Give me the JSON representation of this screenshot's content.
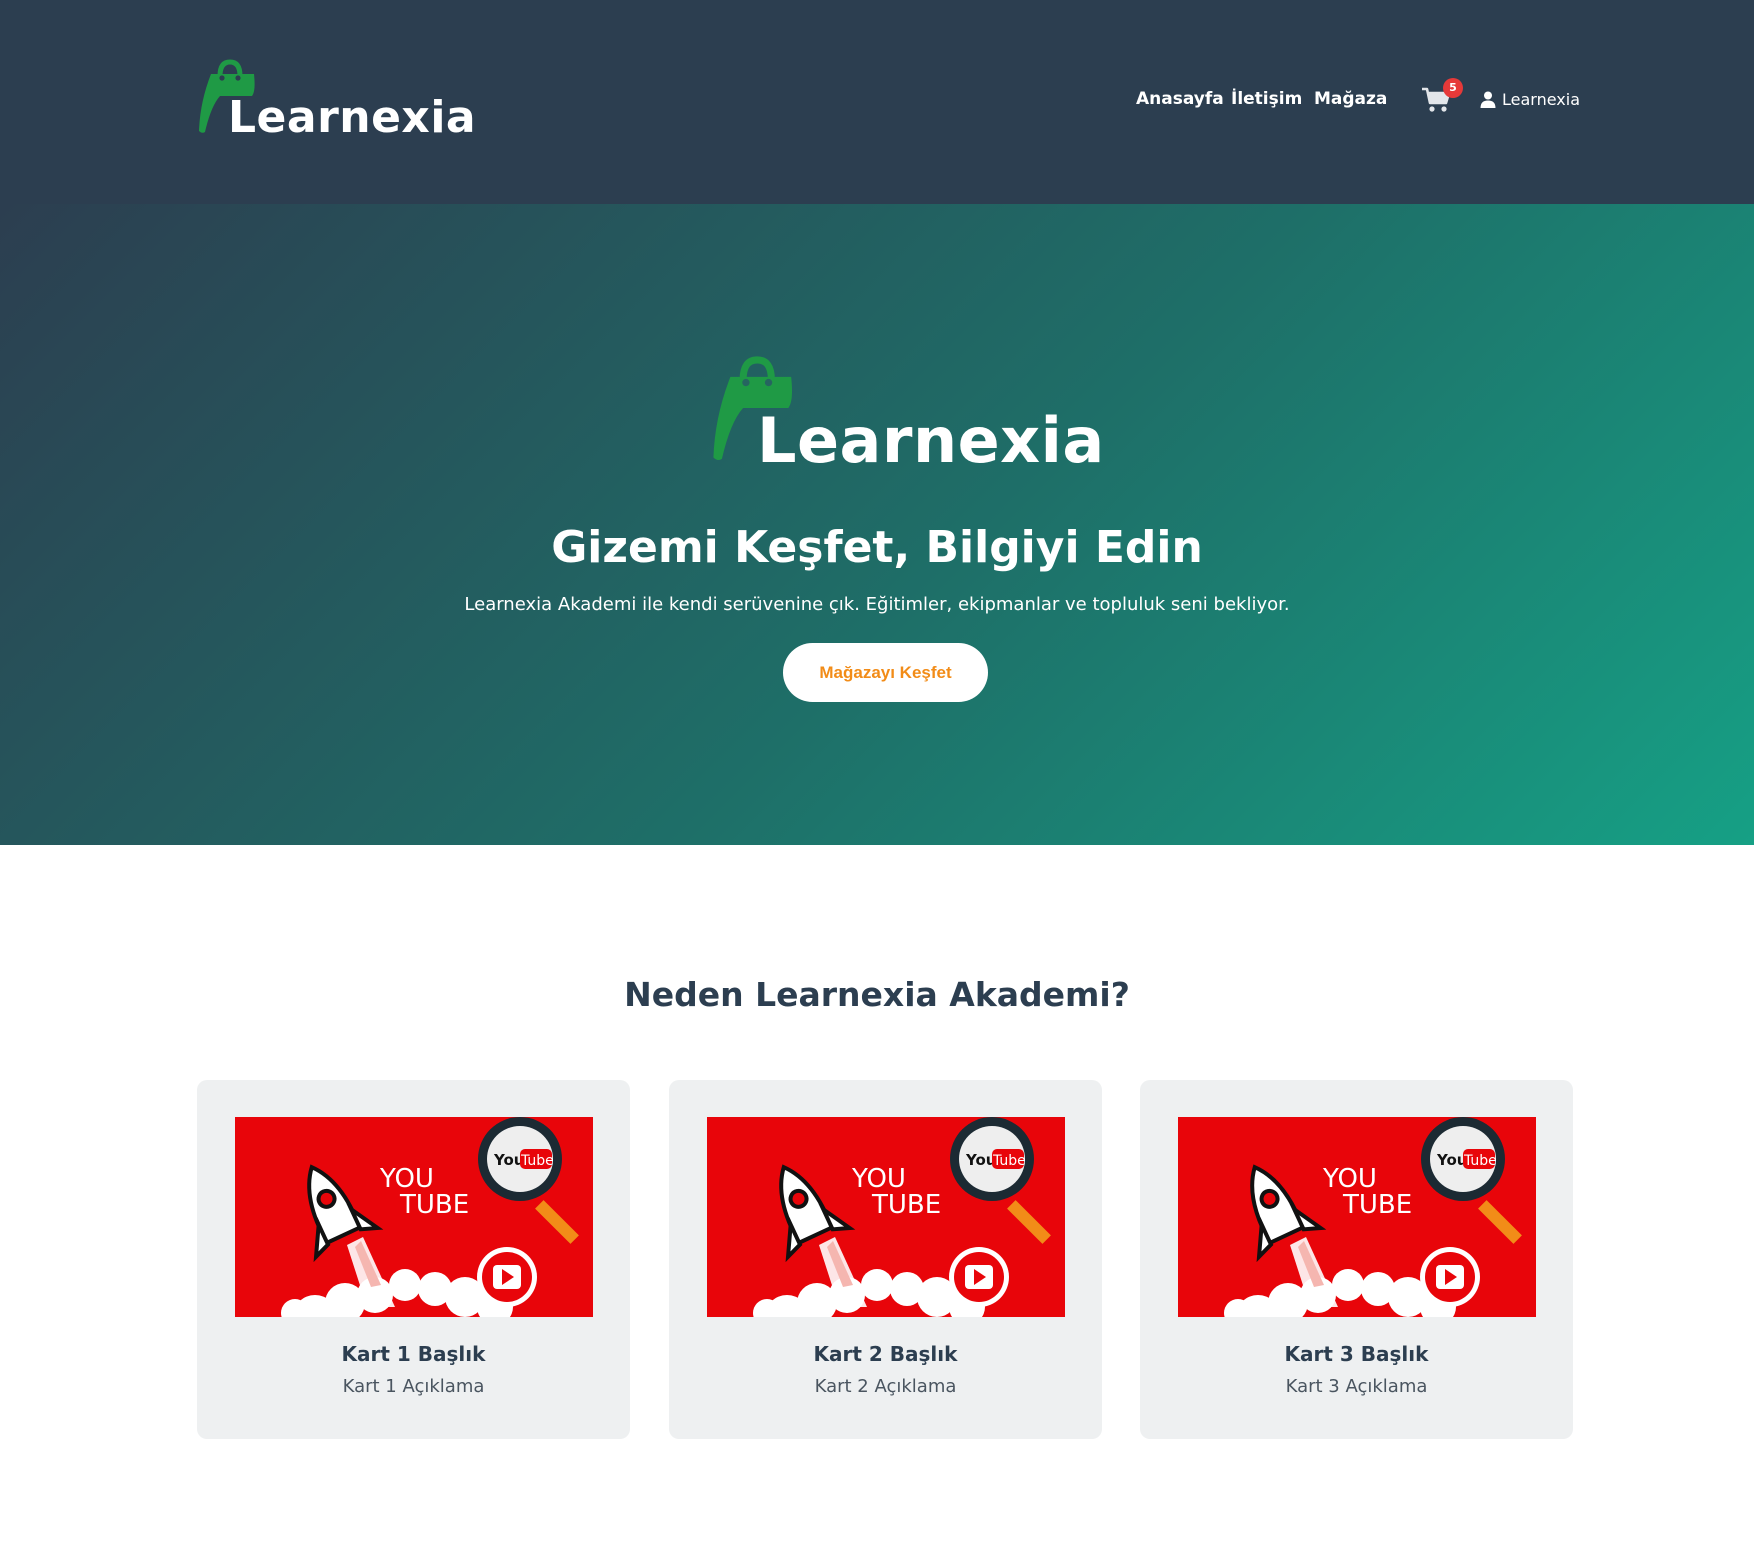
{
  "navbar": {
    "brand_name": "Learnexia",
    "links": [
      "Anasayfa",
      "İletişim",
      "Mağaza"
    ],
    "cart_count": "5",
    "user_name": "Learnexia",
    "icons": {
      "logo": "shopping-bag-logo-icon",
      "cart": "cart-icon",
      "user": "user-icon"
    }
  },
  "hero": {
    "logo_text": "Learnexia",
    "title": "Gizemi Keşfet, Bilgiyi Edin",
    "subtitle": "Learnexia Akademi ile kendi serüvenine çık. Eğitimler, ekipmanlar ve topluluk seni bekliyor.",
    "cta_label": "Mağazayı Keşfet"
  },
  "features": {
    "title": "Neden Learnexia Akademi?",
    "cards": [
      {
        "title": "Kart 1 Başlık",
        "description": "Kart 1 Açıklama"
      },
      {
        "title": "Kart 2 Başlık",
        "description": "Kart 2 Açıklama"
      },
      {
        "title": "Kart 3 Başlık",
        "description": "Kart 3 Açıklama"
      }
    ],
    "thumbnail": {
      "line1": "YOU",
      "line2": "TUBE",
      "badge_you": "You",
      "badge_tube": "Tube"
    }
  },
  "colors": {
    "navbar_bg": "#2c3e50",
    "hero_gradient_start": "#2c3e50",
    "hero_gradient_end": "#16a085",
    "logo_green": "#1f9a45",
    "cta_text": "#f28c18",
    "badge_red": "#e63939",
    "card_bg": "#eef0f1"
  }
}
